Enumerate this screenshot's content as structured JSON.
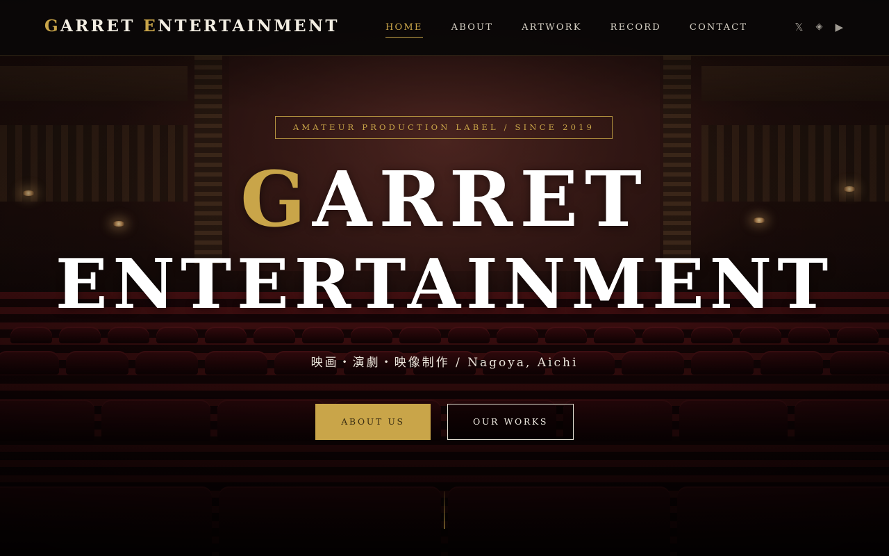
{
  "header": {
    "logo": {
      "g_initial": "G",
      "g_rest": "ARRET ",
      "e_initial": "E",
      "e_rest": "NTERTAINMENT"
    },
    "nav": [
      {
        "label": "HOME",
        "active": true
      },
      {
        "label": "ABOUT",
        "active": false
      },
      {
        "label": "ARTWORK",
        "active": false
      },
      {
        "label": "RECORD",
        "active": false
      },
      {
        "label": "CONTACT",
        "active": false
      }
    ],
    "social": [
      {
        "icon": "x-icon",
        "glyph": "𝕏"
      },
      {
        "icon": "diamond-icon",
        "glyph": "◈"
      },
      {
        "icon": "play-icon",
        "glyph": "▶"
      }
    ]
  },
  "hero": {
    "tagline": "AMATEUR PRODUCTION LABEL / SINCE 2019",
    "title_line1_initial": "G",
    "title_line1_rest": "ARRET",
    "title_line2": "ENTERTAINMENT",
    "subtitle": "映画・演劇・映像制作 / Nagoya, Aichi",
    "primary_button": "ABOUT US",
    "secondary_button": "OUR WORKS"
  },
  "colors": {
    "accent_gold": "#c9a549",
    "header_bg": "#0a0808",
    "text_light": "#f3eee3"
  }
}
